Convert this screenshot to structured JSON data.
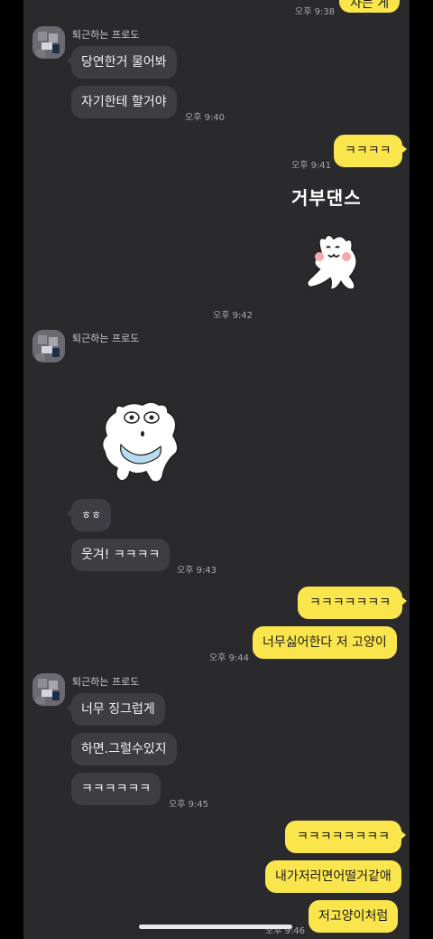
{
  "partner": {
    "name": "퇴근하는 프로도"
  },
  "colors": {
    "chat_background": "#2a292c",
    "incoming_bubble": "#3e3d41",
    "outgoing_bubble": "#fae64c"
  },
  "messages": {
    "top_out_text": "사는 게",
    "top_out_time": "오후 9:38",
    "g1_bubble1": "당연한거 물어봐",
    "g1_bubble2": "자기한테 할거야",
    "g1_time": "오후 9:40",
    "out1_bubble": "ㅋㅋㅋㅋ",
    "out1_time": "오후 9:41",
    "out_sticker_text": "거부댄스",
    "out_sticker_time": "오후 9:42",
    "g2_bubble1": "ㅎㅎ",
    "g2_bubble2": "웃겨! ㅋㅋㅋㅋ",
    "g2_time": "오후 9:43",
    "out2_bubble1": "ㅋㅋㅋㅋㅋㅋㅋ",
    "out2_bubble2": "너무싫어한다 저 고양이",
    "out2_time": "오후 9:44",
    "g3_bubble1": "너무 징그럽게",
    "g3_bubble2": "하면.그럴수있지",
    "g3_bubble3": "ㅋㅋㅋㅋㅋㅋ",
    "g3_time": "오후 9:45",
    "out3_bubble1": "ㅋㅋㅋㅋㅋㅋㅋㅋ",
    "out3_bubble2": "내가저러면어떨거같애",
    "out3_bubble3": "저고양이처럼",
    "out3_time": "오후 9:46"
  },
  "icons": [
    "avatar",
    "dancing-cat-sticker",
    "surprised-cat-sticker",
    "home-indicator"
  ]
}
